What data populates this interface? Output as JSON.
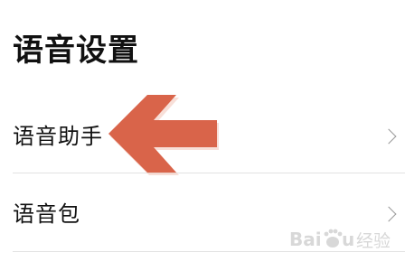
{
  "page": {
    "title": "语音设置"
  },
  "settings": {
    "items": [
      {
        "label": "语音助手"
      },
      {
        "label": "语音包"
      }
    ]
  },
  "annotation": {
    "arrow_color": "#D9644A",
    "arrow_shadow": "#F2C5B8",
    "target": "语音助手"
  },
  "watermark": {
    "text": "Baidu 经验"
  },
  "colors": {
    "background": "#FFFFFF",
    "text": "#111111",
    "chevron": "#9A9A9A",
    "divider": "#E2E2E2"
  }
}
